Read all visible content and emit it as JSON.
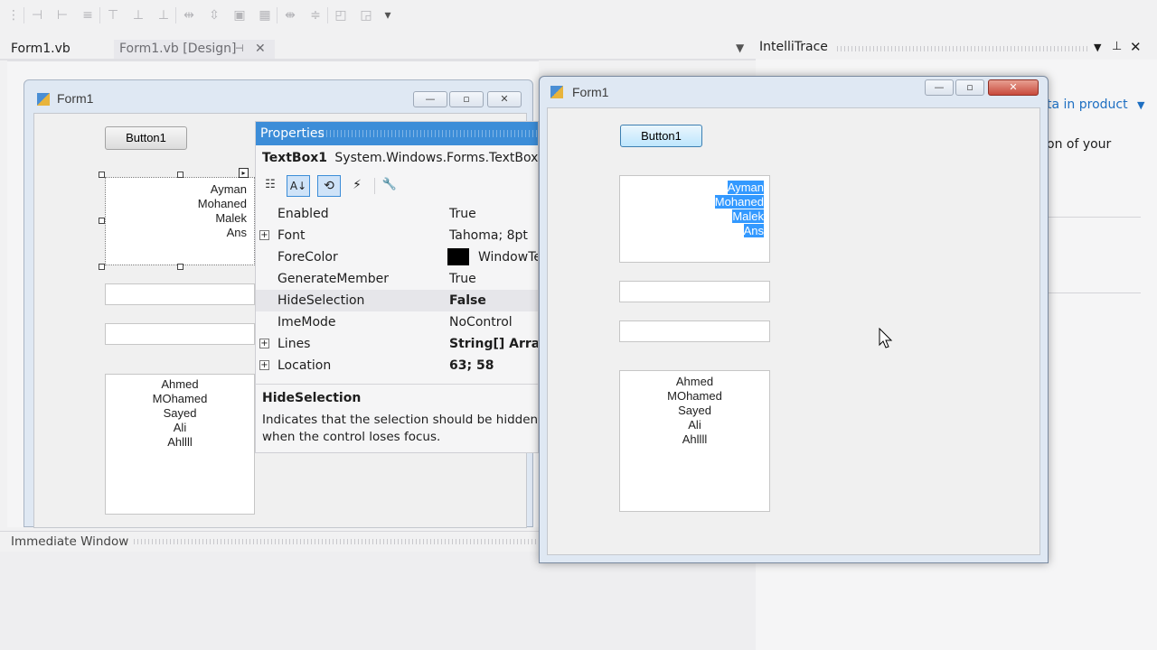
{
  "toolbar": {
    "icons": [
      "align-lefts-icon",
      "align-centers-icon",
      "align-rights-icon",
      "align-tops-icon",
      "align-middles-icon",
      "align-bottoms-icon",
      "same-width-icon",
      "same-height-icon",
      "same-size-icon",
      "size-to-grid-icon",
      "h-spacing-icon",
      "v-spacing-icon",
      "bring-front-icon",
      "send-back-icon"
    ],
    "overflow": "▾"
  },
  "doc_tabs": [
    {
      "label": "Form1.vb"
    },
    {
      "label": "Form1.vb [Design]",
      "pin": "⊣",
      "close": "✕"
    }
  ],
  "designer": {
    "form_title": "Form1",
    "button_label": "Button1",
    "textbox1_lines": [
      "Ayman",
      "Mohaned",
      "Malek",
      "Ans"
    ],
    "list_lines": [
      "Ahmed",
      "MOhamed",
      "Sayed",
      "Ali",
      "Ahllll"
    ]
  },
  "properties": {
    "title": "Properties",
    "object_name": "TextBox1",
    "object_type": "System.Windows.Forms.TextBox",
    "rows": [
      {
        "name": "Enabled",
        "value": "True",
        "expand": ""
      },
      {
        "name": "Font",
        "value": "Tahoma; 8pt",
        "expand": "+"
      },
      {
        "name": "ForeColor",
        "value": "WindowText",
        "expand": ""
      },
      {
        "name": "GenerateMember",
        "value": "True",
        "expand": ""
      },
      {
        "name": "HideSelection",
        "value": "False",
        "expand": ""
      },
      {
        "name": "ImeMode",
        "value": "NoControl",
        "expand": ""
      },
      {
        "name": "Lines",
        "value": "String[] Array",
        "expand": "+"
      },
      {
        "name": "Location",
        "value": "63; 58",
        "expand": "+"
      }
    ],
    "desc_title": "HideSelection",
    "desc_text": "Indicates that the selection should be hidden when the control loses focus."
  },
  "intellitrace": {
    "title": "IntelliTrace",
    "link": "ta in product",
    "text": "on of your"
  },
  "immediate": {
    "title": "Immediate Window"
  },
  "running_form": {
    "title": "Form1",
    "button_label": "Button1",
    "textbox1_lines": [
      "Ayman",
      "Mohaned",
      "Malek",
      "Ans"
    ],
    "list_lines": [
      "Ahmed",
      "MOhamed",
      "Sayed",
      "Ali",
      "Ahllll"
    ],
    "minimize": "—",
    "maximize": "▫",
    "close": "✕"
  },
  "colors": {
    "accent": "#3c8dd8",
    "selection": "#3399ff",
    "close_red": "#c84a3c"
  }
}
